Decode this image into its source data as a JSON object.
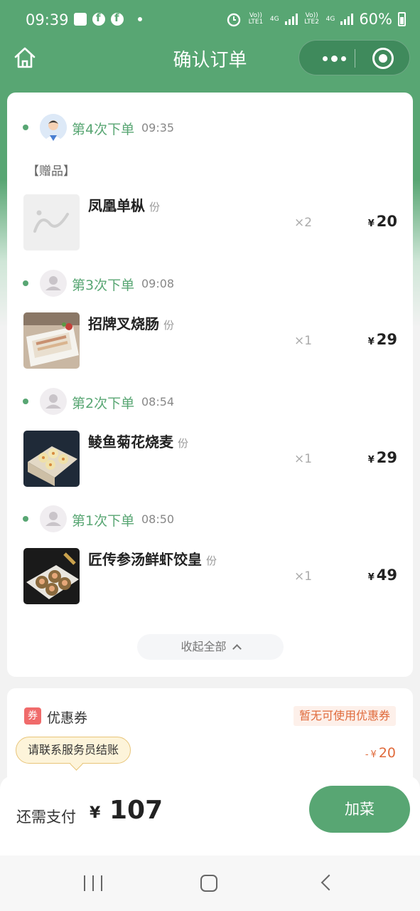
{
  "status_bar": {
    "time": "09:39",
    "sim1": "Vo)) LTE1",
    "sim1_net": "4G",
    "sim2": "Vo)) LTE2",
    "sim2_net": "4G",
    "battery": "60%"
  },
  "nav": {
    "title": "确认订单"
  },
  "orders": [
    {
      "label": "第4次下单",
      "time": "09:35",
      "avatar": "user-photo-avatar",
      "gift_tag": "【赠品】",
      "item": {
        "name": "凤凰单枞",
        "unit": "份",
        "qty": "×2",
        "currency": "¥",
        "price": "20",
        "thumb": "placeholder-image"
      }
    },
    {
      "label": "第3次下单",
      "time": "09:08",
      "avatar": "default-avatar",
      "item": {
        "name": "招牌叉烧肠",
        "unit": "份",
        "qty": "×1",
        "currency": "¥",
        "price": "29",
        "thumb": "rice-roll-photo"
      }
    },
    {
      "label": "第2次下单",
      "time": "08:54",
      "avatar": "default-avatar",
      "item": {
        "name": "鲮鱼菊花烧麦",
        "unit": "份",
        "qty": "×1",
        "currency": "¥",
        "price": "29",
        "thumb": "shaomai-photo"
      }
    },
    {
      "label": "第1次下单",
      "time": "08:50",
      "avatar": "default-avatar",
      "item": {
        "name": "匠传参汤鲜虾饺皇",
        "unit": "份",
        "qty": "×1",
        "currency": "¥",
        "price": "49",
        "thumb": "shrimp-dumpling-photo"
      }
    }
  ],
  "collapse_label": "收起全部",
  "coupon": {
    "icon_text": "券",
    "label": "优惠券",
    "status": "暂无可使用优惠券",
    "discount_prefix": "-",
    "discount_currency": "¥",
    "discount_value": "20"
  },
  "tip": "请联系服务员结账",
  "footer": {
    "pay_label": "还需支付",
    "currency": "¥",
    "amount": "107",
    "add_button": "加菜"
  },
  "colors": {
    "brand_green": "#58a673",
    "discount_orange": "#e06a3b"
  }
}
